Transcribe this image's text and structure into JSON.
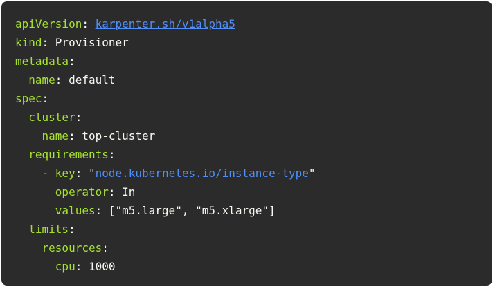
{
  "code": {
    "lines": [
      {
        "indent": "",
        "key": "apiVersion",
        "sep": ": ",
        "value": "",
        "link": "karpenter.sh/v1alpha5",
        "tail": ""
      },
      {
        "indent": "",
        "key": "kind",
        "sep": ": ",
        "value": "Provisioner",
        "link": "",
        "tail": ""
      },
      {
        "indent": "",
        "key": "metadata",
        "sep": ":",
        "value": "",
        "link": "",
        "tail": ""
      },
      {
        "indent": "  ",
        "key": "name",
        "sep": ": ",
        "value": "default",
        "link": "",
        "tail": ""
      },
      {
        "indent": "",
        "key": "spec",
        "sep": ":",
        "value": "",
        "link": "",
        "tail": ""
      },
      {
        "indent": "  ",
        "key": "cluster",
        "sep": ":",
        "value": "",
        "link": "",
        "tail": ""
      },
      {
        "indent": "    ",
        "key": "name",
        "sep": ": ",
        "value": "top-cluster",
        "link": "",
        "tail": ""
      },
      {
        "indent": "  ",
        "key": "requirements",
        "sep": ":",
        "value": "",
        "link": "",
        "tail": ""
      },
      {
        "indent": "    - ",
        "key": "key",
        "sep": ": ",
        "value": "\"",
        "link": "node.kubernetes.io/instance-type",
        "tail": "\""
      },
      {
        "indent": "      ",
        "key": "operator",
        "sep": ": ",
        "value": "In",
        "link": "",
        "tail": ""
      },
      {
        "indent": "      ",
        "key": "values",
        "sep": ": ",
        "value": "[\"m5.large\", \"m5.xlarge\"]",
        "link": "",
        "tail": ""
      },
      {
        "indent": "  ",
        "key": "limits",
        "sep": ":",
        "value": "",
        "link": "",
        "tail": ""
      },
      {
        "indent": "    ",
        "key": "resources",
        "sep": ":",
        "value": "",
        "link": "",
        "tail": ""
      },
      {
        "indent": "      ",
        "key": "cpu",
        "sep": ": ",
        "value": "1000",
        "link": "",
        "tail": ""
      }
    ]
  },
  "colors": {
    "background": "#2b2b2b",
    "key": "#a6e22e",
    "text": "#f8f8f2",
    "link": "#4f8ff7"
  }
}
